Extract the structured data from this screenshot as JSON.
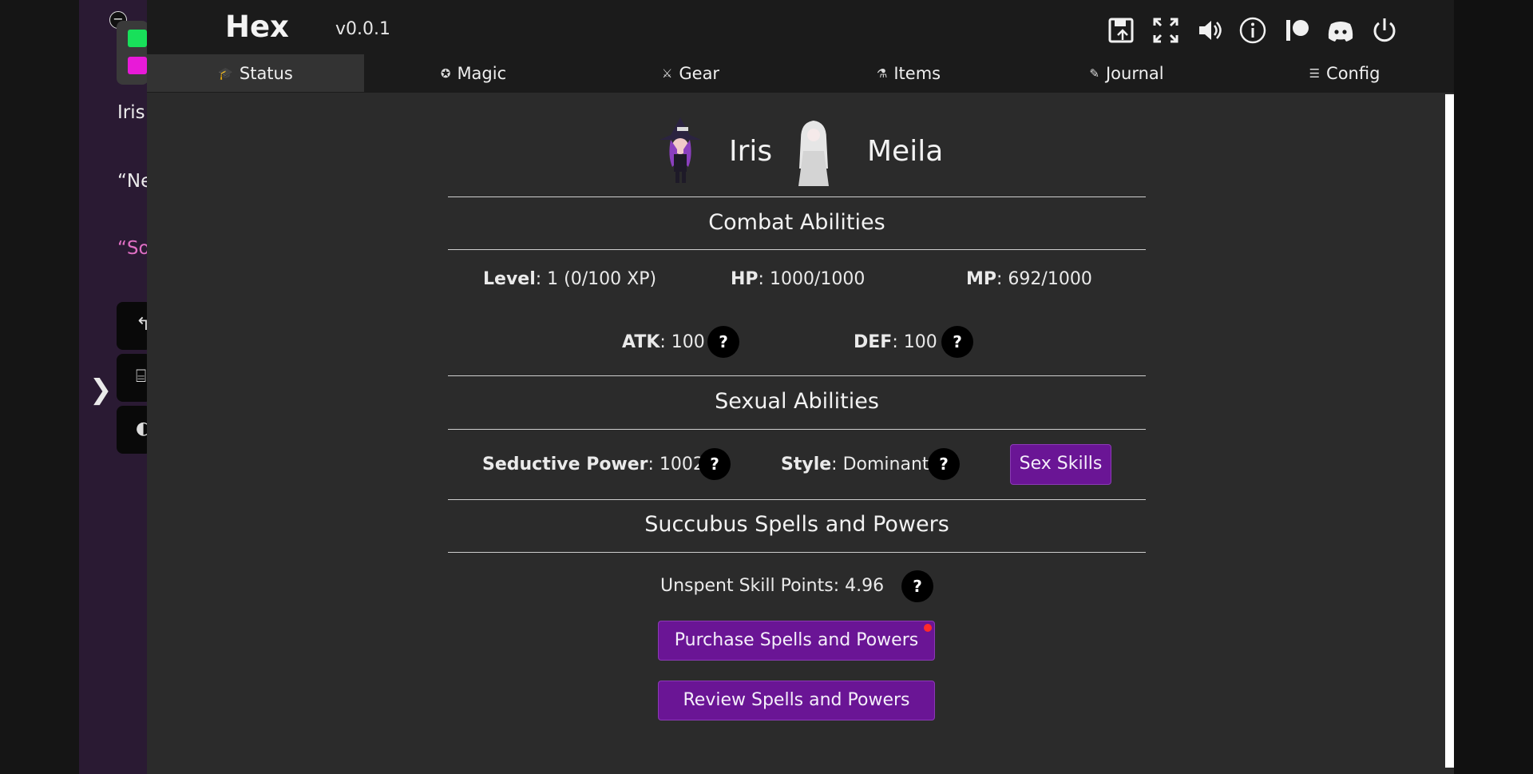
{
  "background": {
    "texts": [
      "Iris",
      "“Ne",
      "“So"
    ],
    "colors": {
      "swatch1": "#18e05a",
      "swatch2": "#e81ad8",
      "accent_text": "#e06fc4"
    }
  },
  "header": {
    "title": "Hex",
    "version": "v0.0.1",
    "icons": [
      "save-icon",
      "fullscreen-icon",
      "volume-icon",
      "info-icon",
      "patreon-icon",
      "discord-icon",
      "power-icon"
    ]
  },
  "tabs": [
    {
      "label": "Status",
      "icon": "status-icon",
      "active": true
    },
    {
      "label": "Magic",
      "icon": "magic-icon",
      "active": false
    },
    {
      "label": "Gear",
      "icon": "gear-icon",
      "active": false
    },
    {
      "label": "Items",
      "icon": "items-icon",
      "active": false
    },
    {
      "label": "Journal",
      "icon": "journal-icon",
      "active": false
    },
    {
      "label": "Config",
      "icon": "config-icon",
      "active": false
    }
  ],
  "characters": [
    {
      "name": "Iris"
    },
    {
      "name": "Meila"
    }
  ],
  "combat": {
    "heading": "Combat Abilities",
    "level_label": "Level",
    "level_value": ": 1 (0/100 XP)",
    "hp_label": "HP",
    "hp_value": ": 1000/1000",
    "mp_label": "MP",
    "mp_value": ": 692/1000",
    "atk_label": "ATK",
    "atk_value": ": 100",
    "def_label": "DEF",
    "def_value": ": 100",
    "help": "?"
  },
  "sexual": {
    "heading": "Sexual Abilities",
    "seductive_label": "Seductive Power",
    "seductive_value": ": 1002",
    "style_label": "Style",
    "style_value": ": Dominant",
    "skills_button": "Sex Skills",
    "help": "?"
  },
  "spells": {
    "heading": "Succubus Spells and Powers",
    "points_label": "Unspent Skill Points",
    "points_value": ": 4.96",
    "purchase_button": "Purchase Spells and Powers",
    "review_button": "Review Spells and Powers",
    "help": "?"
  },
  "colors": {
    "accent": "#6a1595",
    "panel": "#2b2b2b",
    "topbar": "#1b1b1b",
    "notification": "#ff2a2a"
  }
}
